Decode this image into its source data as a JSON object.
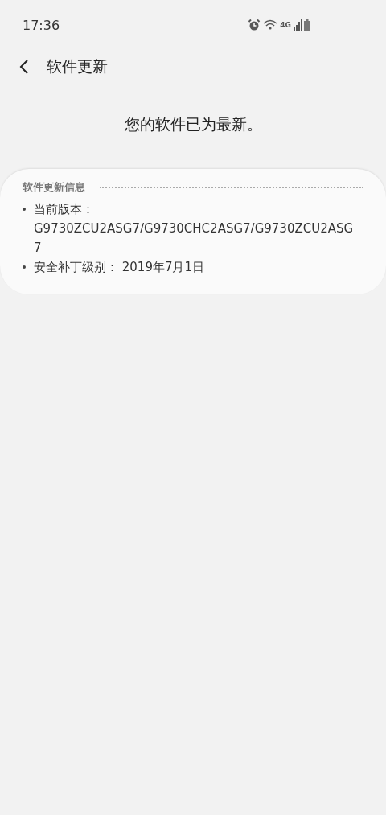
{
  "status_bar": {
    "time": "17:36",
    "network": "4G"
  },
  "header": {
    "title": "软件更新"
  },
  "message": "您的软件已为最新。",
  "info_card": {
    "title": "软件更新信息",
    "items": [
      {
        "text": "当前版本：G9730ZCU2ASG7/G9730CHC2ASG7/G9730ZCU2ASG7"
      },
      {
        "text": "安全补丁级别： 2019年7月1日"
      }
    ]
  }
}
